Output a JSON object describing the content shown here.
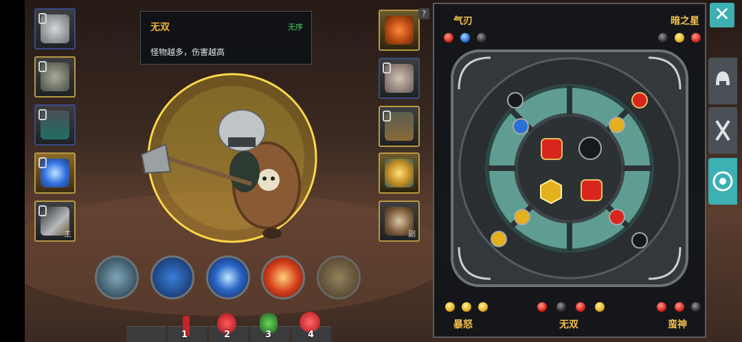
{
  "tooltip": {
    "title": "无双",
    "tag": "无序",
    "desc": "怪物越多，伤害越高"
  },
  "left_equipment": [
    {
      "name": "helmet-icon",
      "border": "blue"
    },
    {
      "name": "chest-armor-icon",
      "border": "gold"
    },
    {
      "name": "belt-icon",
      "border": "blue"
    },
    {
      "name": "ring-icon",
      "border": "gold"
    },
    {
      "name": "axe-icon",
      "border": "gold",
      "badge": "主"
    }
  ],
  "right_equipment": [
    {
      "name": "amulet-icon",
      "border": "gold"
    },
    {
      "name": "gloves-icon",
      "border": "blue"
    },
    {
      "name": "boots-icon",
      "border": "gold"
    },
    {
      "name": "gold-ring-icon",
      "border": "gold"
    },
    {
      "name": "shield-icon",
      "border": "gold",
      "badge": "副"
    }
  ],
  "skills": [
    "sword-strike-skill-icon",
    "dash-skill-icon",
    "shatter-skill-icon",
    "blade-rain-skill-icon",
    "spin-skill-icon"
  ],
  "potions": [
    {
      "name": "small-red-potion-icon",
      "count": "1"
    },
    {
      "name": "red-potion-icon",
      "count": "2"
    },
    {
      "name": "green-potion-icon",
      "count": "3"
    },
    {
      "name": "large-red-potion-icon",
      "count": "4"
    }
  ],
  "panel": {
    "top_left_label": "气刃",
    "top_right_label": "暗之星",
    "bottom_left_label": "暴怒",
    "bottom_center_label": "无双",
    "bottom_right_label": "蛮神",
    "top_left_gems": [
      "red",
      "blue",
      "black"
    ],
    "top_right_gems": [
      "black",
      "gold",
      "red"
    ],
    "bottom_left_gems": [
      "gold",
      "gold",
      "gold"
    ],
    "bottom_center_gems": [
      "red",
      "black",
      "red",
      "gold"
    ],
    "bottom_right_gems": [
      "red",
      "red",
      "black"
    ]
  },
  "help_label": "?",
  "close_label": "✕",
  "colors": {
    "accent": "#3cb0b3",
    "gold_text": "#f1c04a",
    "green_text": "#43d35a"
  },
  "side_tabs": [
    "helmet-tab-icon",
    "weapons-tab-icon",
    "gem-wheel-tab-icon"
  ]
}
